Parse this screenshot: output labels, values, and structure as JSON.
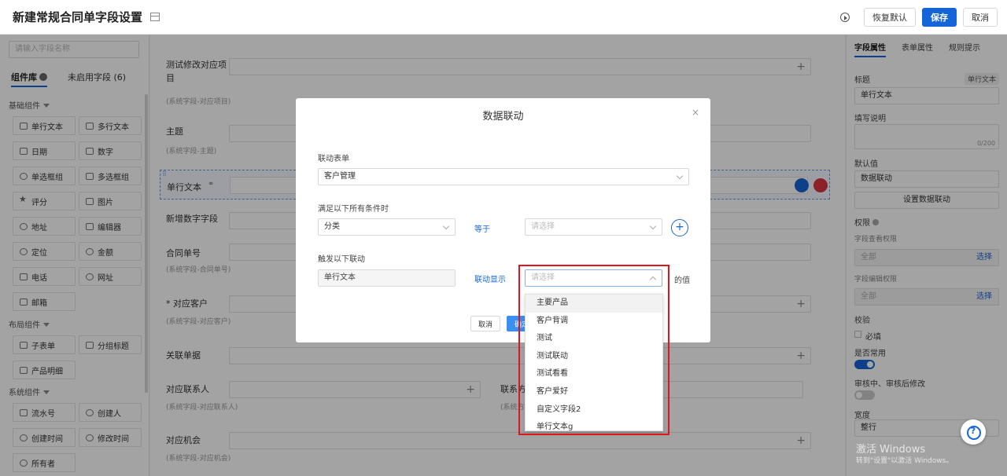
{
  "header": {
    "title": "新建常规合同单字段设置",
    "restore_label": "恢复默认",
    "save_label": "保存",
    "cancel_label": "取消"
  },
  "left": {
    "search_placeholder": "请输入字段名称",
    "tabs": {
      "library": "组件库",
      "unused": "未启用字段 (6)"
    },
    "groups": {
      "basic": "基础组件",
      "layout": "布局组件",
      "system": "系统组件"
    },
    "basic_items": [
      "单行文本",
      "多行文本",
      "日期",
      "数字",
      "单选框组",
      "多选框组",
      "评分",
      "图片",
      "地址",
      "编辑器",
      "定位",
      "金额",
      "电话",
      "网址",
      "邮箱"
    ],
    "layout_items": [
      "子表单",
      "分组标题",
      "产品明细"
    ],
    "system_items": [
      "流水号",
      "创建人",
      "创建时间",
      "修改时间",
      "所有者"
    ]
  },
  "center": {
    "fields": [
      {
        "label": "测试修改对应项目",
        "sub": "(系统字段-对应项目)"
      },
      {
        "label": "主题",
        "sub": "(系统字段-主题)"
      },
      {
        "label": "单行文本",
        "sub": ""
      },
      {
        "label": "新增数字字段",
        "sub": ""
      },
      {
        "label": "合同单号",
        "sub": "(系统字段-合同单号)"
      },
      {
        "label": "* 对应客户",
        "sub": "(系统字段-对应客户)"
      },
      {
        "label": "关联单据",
        "sub": ""
      },
      {
        "label": "对应联系人",
        "sub": "(系统字段-对应联系人)"
      },
      {
        "label": "对应机会",
        "sub": "(系统字段-对应机会)"
      }
    ],
    "extra_label": "联系方",
    "extra_sub": "(系统方"
  },
  "right": {
    "tabs": {
      "field": "字段属性",
      "form": "表单属性",
      "rules": "规则提示"
    },
    "title_label": "标题",
    "title_tag": "单行文本",
    "title_value": "单行文本",
    "desc_label": "填写说明",
    "desc_count": "0/200",
    "default_label": "默认值",
    "default_value": "数据联动",
    "set_link_label": "设置数据联动",
    "perm_label": "权限",
    "view_perm_label": "字段查看权限",
    "view_perm_value": "全部",
    "edit_perm_label": "字段编辑权限",
    "edit_perm_value": "全部",
    "select_link": "选择",
    "validate_label": "校验",
    "required_label": "必填",
    "common_label": "是否常用",
    "audit_label": "审核中、审核后修改",
    "width_label": "宽度",
    "width_value": "整行"
  },
  "modal": {
    "title": "数据联动",
    "close": "×",
    "form_label": "联动表单",
    "form_value": "客户管理",
    "cond_label": "满足以下所有条件时",
    "cond_field": "分类",
    "cond_op": "等于",
    "cond_value_placeholder": "请选择",
    "trigger_label": "触发以下联动",
    "trigger_field": "单行文本",
    "trigger_op": "联动显示",
    "trigger_value_placeholder": "请选择",
    "trigger_suffix": "的值",
    "cancel_label": "取消",
    "confirm_label": "确定"
  },
  "dropdown": {
    "options": [
      "主要产品",
      "客户背调",
      "测试",
      "测试联动",
      "测试看看",
      "客户爱好",
      "自定义字段2",
      "单行文本g"
    ]
  },
  "watermark": {
    "line1": "激活 Windows",
    "line2": "转到\"设置\"以激活 Windows。"
  },
  "help_icon": "?",
  "colors": {
    "primary": "#1665d8",
    "highlight": "#e0151b",
    "overlay": "rgba(0,0,0,0.36)"
  }
}
